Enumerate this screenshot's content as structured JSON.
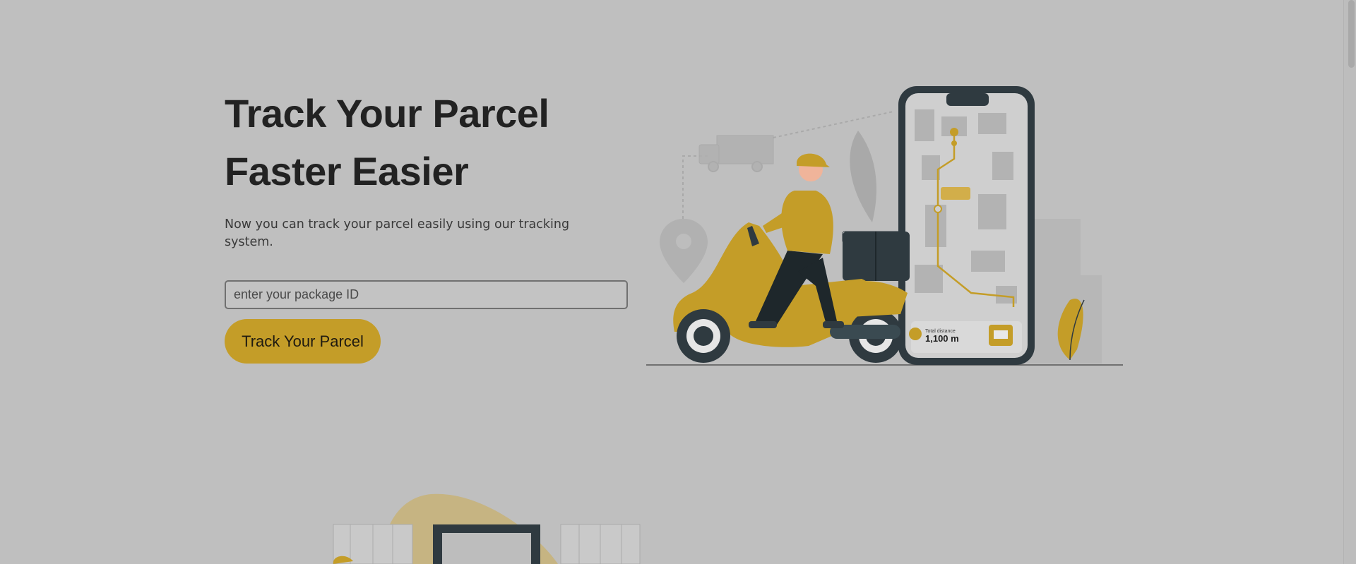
{
  "hero": {
    "title_line1": "Track Your Parcel",
    "title_line2": "Faster Easier",
    "subtitle": "Now you can track your parcel easily using our tracking system."
  },
  "search": {
    "placeholder": "enter your package ID",
    "value": ""
  },
  "button": {
    "label": "Track Your Parcel"
  },
  "illustration": {
    "phone_total_label": "Total distance",
    "phone_total_value": "1,100 m"
  },
  "colors": {
    "accent": "#c49d28",
    "dark": "#2f3a40",
    "background": "#bfbfbf"
  }
}
